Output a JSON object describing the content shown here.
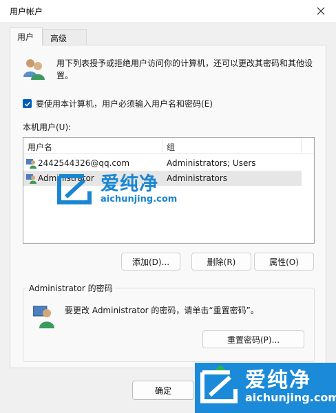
{
  "window": {
    "title": "用户帐户"
  },
  "tabs": [
    {
      "label": "用户"
    },
    {
      "label": "高级"
    }
  ],
  "intro": {
    "text": "用下列表授予或拒绝用户访问你的计算机，还可以更改其密码和其他设置。"
  },
  "require_login": {
    "label": "要使用本计算机，用户必须输入用户名和密码(E)",
    "checked": true
  },
  "local_users": {
    "label": "本机用户(U):",
    "columns": [
      "用户名",
      "组"
    ],
    "rows": [
      {
        "name": "2442544326@qq.com",
        "group": "Administrators; Users",
        "selected": false
      },
      {
        "name": "Administrator",
        "group": "Administrators",
        "selected": true
      }
    ]
  },
  "buttons": {
    "add": "添加(D)...",
    "remove": "删除(R)",
    "properties": "属性(O)"
  },
  "password_group": {
    "title": "Administrator 的密码",
    "text": "要更改 Administrator 的密码，请单击“重置密码”。",
    "reset_button": "重置密码(P)..."
  },
  "footer": {
    "ok": "确定"
  },
  "watermark": {
    "cn": "爱纯净",
    "url": "aichunjing.com"
  },
  "colors": {
    "accent": "#005fb8",
    "watermark": "#1a86d1"
  }
}
